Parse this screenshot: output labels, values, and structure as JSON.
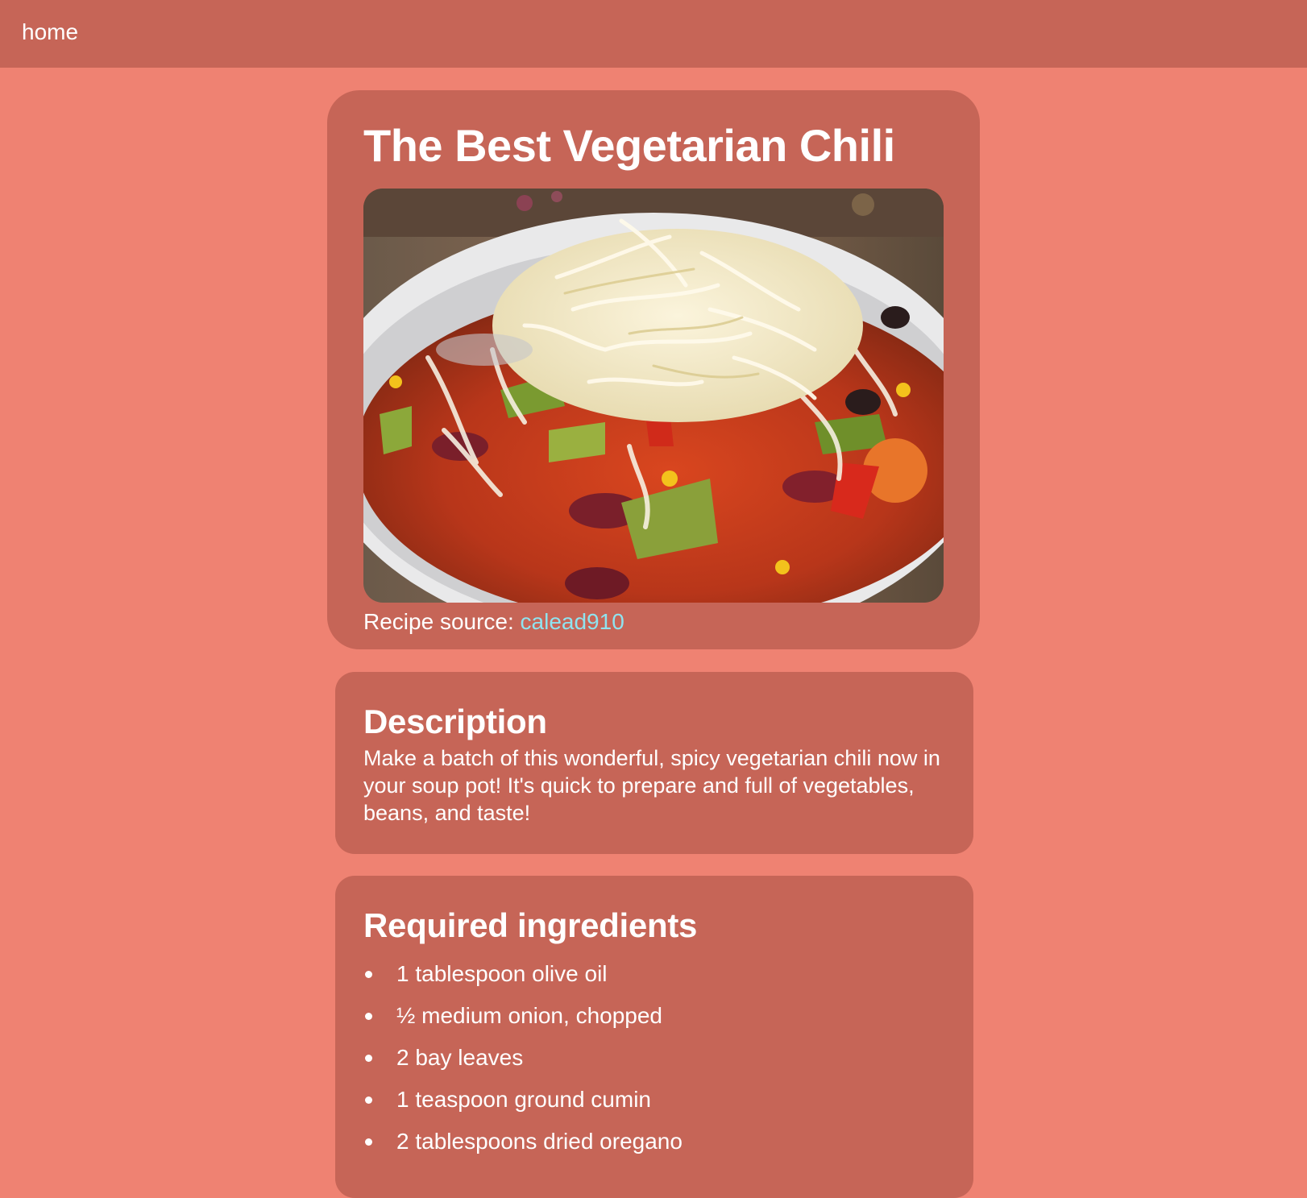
{
  "nav": {
    "home_label": "home"
  },
  "recipe": {
    "title": "The Best Vegetarian Chili",
    "image_alt": "Bowl of vegetarian chili topped with shredded cheese",
    "source_label": "Recipe source: ",
    "source_author": "calead910"
  },
  "description": {
    "heading": "Description",
    "text": "Make a batch of this wonderful, spicy vegetarian chili now in your soup pot! It's quick to prepare and full of vegetables, beans, and taste!"
  },
  "ingredients": {
    "heading": "Required ingredients",
    "items": [
      "1 tablespoon olive oil",
      "½ medium onion, chopped",
      "2 bay leaves",
      "1 teaspoon ground cumin",
      "2 tablespoons dried oregano"
    ]
  },
  "colors": {
    "page_background": "#ef8272",
    "card_background": "#c66557",
    "text": "#ffffff",
    "link": "#8fe3ef"
  }
}
